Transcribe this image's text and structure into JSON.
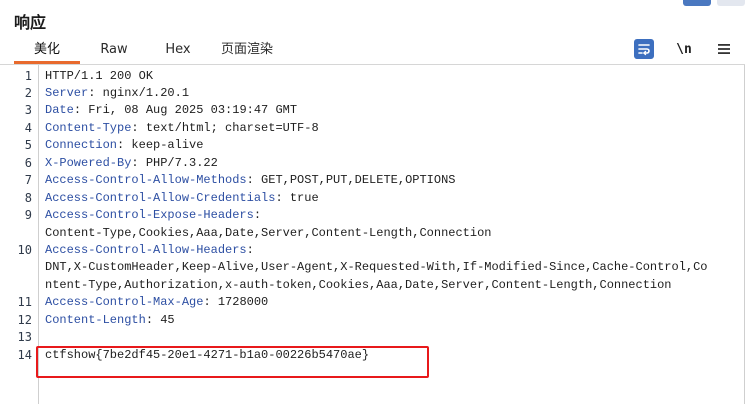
{
  "panel": {
    "title": "响应"
  },
  "tabs": [
    {
      "label": "美化",
      "active": true
    },
    {
      "label": "Raw",
      "active": false
    },
    {
      "label": "Hex",
      "active": false
    },
    {
      "label": "页面渲染",
      "active": false
    }
  ],
  "toolbar": {
    "wrap_icon": "word-wrap-icon",
    "newline_label": "\\n",
    "menu_icon": "hamburger-menu-icon"
  },
  "colors": {
    "accent": "#e86a2d",
    "header_key": "#2d4fa3",
    "highlight_box": "#e8191b",
    "wrap_button": "#3d6fbf"
  },
  "lines": [
    {
      "num": "1",
      "parts": [
        {
          "t": "HTTP/1.1 200 OK",
          "k": false
        }
      ]
    },
    {
      "num": "2",
      "parts": [
        {
          "t": "Server",
          "k": true
        },
        {
          "t": ": nginx/1.20.1",
          "k": false
        }
      ]
    },
    {
      "num": "3",
      "parts": [
        {
          "t": "Date",
          "k": true
        },
        {
          "t": ": Fri, 08 Aug 2025 03:19:47 GMT",
          "k": false
        }
      ]
    },
    {
      "num": "4",
      "parts": [
        {
          "t": "Content-Type",
          "k": true
        },
        {
          "t": ": text/html; charset=UTF-8",
          "k": false
        }
      ]
    },
    {
      "num": "5",
      "parts": [
        {
          "t": "Connection",
          "k": true
        },
        {
          "t": ": keep-alive",
          "k": false
        }
      ]
    },
    {
      "num": "6",
      "parts": [
        {
          "t": "X-Powered-By",
          "k": true
        },
        {
          "t": ": PHP/7.3.22",
          "k": false
        }
      ]
    },
    {
      "num": "7",
      "parts": [
        {
          "t": "Access-Control-Allow-Methods",
          "k": true
        },
        {
          "t": ": GET,POST,PUT,DELETE,OPTIONS",
          "k": false
        }
      ]
    },
    {
      "num": "8",
      "parts": [
        {
          "t": "Access-Control-Allow-Credentials",
          "k": true
        },
        {
          "t": ": true",
          "k": false
        }
      ]
    },
    {
      "num": "9",
      "parts": [
        {
          "t": "Access-Control-Expose-Headers",
          "k": true
        },
        {
          "t": ":",
          "k": false
        }
      ]
    },
    {
      "num": "",
      "parts": [
        {
          "t": "Content-Type,Cookies,Aaa,Date,Server,Content-Length,Connection",
          "k": false
        }
      ]
    },
    {
      "num": "10",
      "parts": [
        {
          "t": "Access-Control-Allow-Headers",
          "k": true
        },
        {
          "t": ":",
          "k": false
        }
      ]
    },
    {
      "num": "",
      "parts": [
        {
          "t": "DNT,X-CustomHeader,Keep-Alive,User-Agent,X-Requested-With,If-Modified-Since,Cache-Control,Co",
          "k": false
        }
      ]
    },
    {
      "num": "",
      "parts": [
        {
          "t": "ntent-Type,Authorization,x-auth-token,Cookies,Aaa,Date,Server,Content-Length,Connection",
          "k": false
        }
      ]
    },
    {
      "num": "11",
      "parts": [
        {
          "t": "Access-Control-Max-Age",
          "k": true
        },
        {
          "t": ": 1728000",
          "k": false
        }
      ]
    },
    {
      "num": "12",
      "parts": [
        {
          "t": "Content-Length",
          "k": true
        },
        {
          "t": ": 45",
          "k": false
        }
      ]
    },
    {
      "num": "13",
      "parts": []
    },
    {
      "num": "14",
      "parts": [
        {
          "t": "ctfshow{7be2df45-20e1-4271-b1a0-00226b5470ae}",
          "k": false
        }
      ]
    }
  ]
}
